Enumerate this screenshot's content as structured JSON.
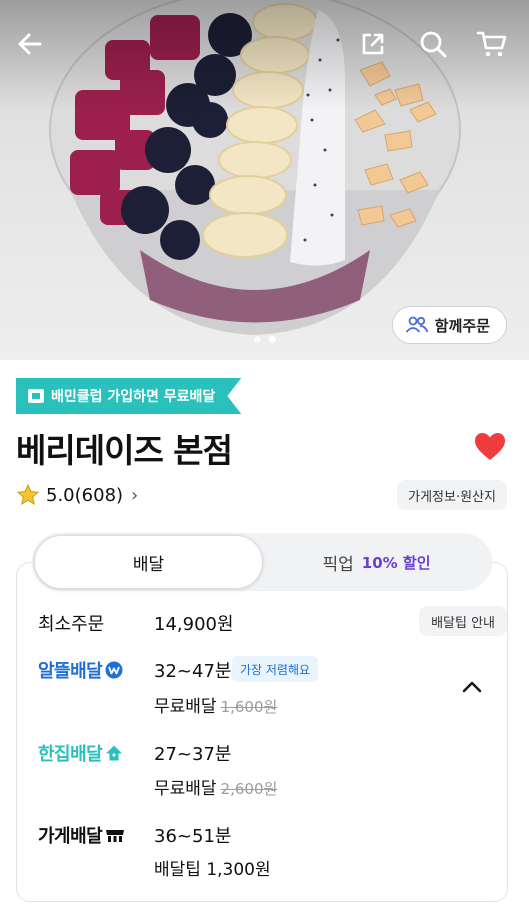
{
  "hero": {
    "group_order_label": "함께주문",
    "pager_total": 2,
    "pager_active": 2
  },
  "promo": {
    "label": "배민클럽 가입하면 무료배달",
    "color": "#2ac1bc"
  },
  "store": {
    "name": "베리데이즈 본점",
    "rating": "5.0",
    "review_count": "(608)",
    "info_label": "가게정보·원산지",
    "favorited": true
  },
  "tabs": [
    {
      "label": "배달",
      "active": true
    },
    {
      "label": "픽업",
      "discount": "10% 할인",
      "active": false
    }
  ],
  "delivery": {
    "min_order_label": "최소주문",
    "min_order_value": "14,900원",
    "tip_info_label": "배달팁 안내",
    "options": [
      {
        "brand": "알뜰배달",
        "brand_color": "#1f6fd6",
        "time": "32~47분",
        "badge": "가장 저렴해요",
        "fee": "무료배달",
        "original_fee": "1,600원"
      },
      {
        "brand": "한집배달",
        "brand_color": "#2ac1bc",
        "time": "27~37분",
        "fee": "무료배달",
        "original_fee": "2,600원"
      },
      {
        "brand": "가게배달",
        "brand_color": "#111111",
        "time": "36~51분",
        "fee": "배달팁 1,300원"
      }
    ]
  },
  "colors": {
    "heart": "#f03c3c",
    "star": "#f7c531",
    "discount": "#6b3fd4"
  }
}
